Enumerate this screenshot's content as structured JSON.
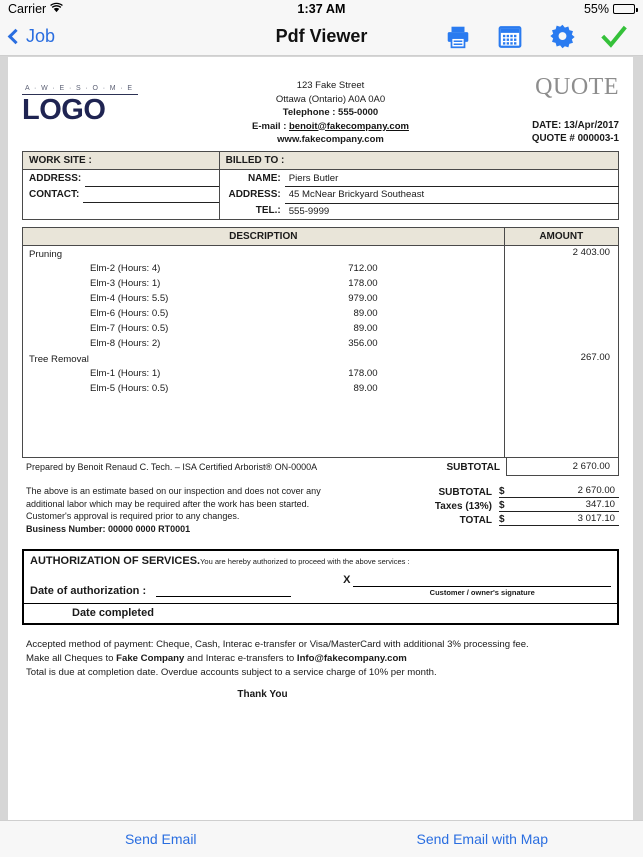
{
  "status_bar": {
    "carrier": "Carrier",
    "wifi_icon": "wifi-icon",
    "time": "1:37 AM",
    "battery_percent": "55%",
    "battery_level": 55
  },
  "nav_bar": {
    "back_label": "Job",
    "title": "Pdf Viewer",
    "actions": [
      {
        "name": "print-icon",
        "label": "Print"
      },
      {
        "name": "calendar-icon",
        "label": "Calendar"
      },
      {
        "name": "gear-icon",
        "label": "Settings"
      },
      {
        "name": "checkmark-icon",
        "label": "Done"
      }
    ],
    "accent_color": "#2a6ee0",
    "check_color": "#35c13a"
  },
  "document": {
    "logo": {
      "tagline": "A · W · E · S · O · M · E",
      "name": "LOGO",
      "color": "#1f2452"
    },
    "company": {
      "street": "123 Fake Street",
      "city": "Ottawa (Ontario) A0A 0A0",
      "telephone": "Telephone : 555-0000",
      "email_label": "E-mail : ",
      "email": "benoit@fakecompany.com",
      "website": "www.fakecompany.com"
    },
    "quote_header": {
      "word": "QUOTE",
      "date": "DATE: 13/Apr/2017",
      "number": "QUOTE # 000003-1"
    },
    "work_site": {
      "header": "WORK SITE :",
      "address_label": "ADDRESS:",
      "address_value": "",
      "contact_label": "CONTACT:",
      "contact_value": ""
    },
    "billed_to": {
      "header": "BILLED TO :",
      "name_label": "NAME:",
      "name_value": "Piers Butler",
      "address_label": "ADDRESS:",
      "address_value": "45 McNear Brickyard Southeast",
      "tel_label": "TEL.:",
      "tel_value": "555-9999"
    },
    "line_table": {
      "col_description": "DESCRIPTION",
      "col_amount": "AMOUNT",
      "groups": [
        {
          "name": "Pruning",
          "amount": "2 403.00",
          "items": [
            {
              "label": "Elm-2 (Hours: 4)",
              "price": "712.00"
            },
            {
              "label": "Elm-3 (Hours: 1)",
              "price": "178.00"
            },
            {
              "label": "Elm-4 (Hours: 5.5)",
              "price": "979.00"
            },
            {
              "label": "Elm-6 (Hours: 0.5)",
              "price": "89.00"
            },
            {
              "label": "Elm-7 (Hours: 0.5)",
              "price": "89.00"
            },
            {
              "label": "Elm-8 (Hours: 2)",
              "price": "356.00"
            }
          ]
        },
        {
          "name": "Tree Removal",
          "amount": "267.00",
          "items": [
            {
              "label": "Elm-1 (Hours: 1)",
              "price": "178.00"
            },
            {
              "label": "Elm-5 (Hours: 0.5)",
              "price": "89.00"
            }
          ]
        }
      ]
    },
    "prepared_by": "Prepared by Benoit Renaud C. Tech. – ISA Certified Arborist® ON-0000A",
    "subtotal_strip": {
      "label": "SUBTOTAL",
      "value": "2 670.00"
    },
    "terms": {
      "line1": "The above is an estimate based on our inspection and does not cover any",
      "line2": "additional labor which may be required after the work has been started.",
      "line3": "Customer's approval is required prior to any changes.",
      "business_number": "Business Number: 00000 0000 RT0001"
    },
    "totals": {
      "currency": "$",
      "rows": [
        {
          "label": "SUBTOTAL",
          "value": "2 670.00"
        },
        {
          "label": "Taxes (13%)",
          "value": "347.10"
        },
        {
          "label": "TOTAL",
          "value": "3 017.10"
        }
      ]
    },
    "authorization": {
      "title": "AUTHORIZATION OF SERVICES.",
      "subtitle": "You are hereby authorized to proceed with the above services :",
      "date_label": "Date of authorization :",
      "date_value": "",
      "signature_mark": "X",
      "signature_value": "",
      "signature_caption": "Customer / owner's signature",
      "date_completed_label": "Date completed"
    },
    "footer": {
      "payment_line_a": "Accepted method of payment: Cheque, Cash, Interac e-transfer or Visa/MasterCard with additional 3% processing fee.",
      "cheques_pre": "Make all Cheques to ",
      "cheques_company": "Fake Company",
      "cheques_mid": " and Interac e-transfers to ",
      "cheques_email": "Info@fakecompany.com",
      "overdue_line": "Total is due at completion date. Overdue accounts subject to a service charge of 10% per month.",
      "thank_you": "Thank You"
    }
  },
  "toolbar": {
    "send_email": "Send Email",
    "send_email_with_map": "Send Email with Map"
  }
}
